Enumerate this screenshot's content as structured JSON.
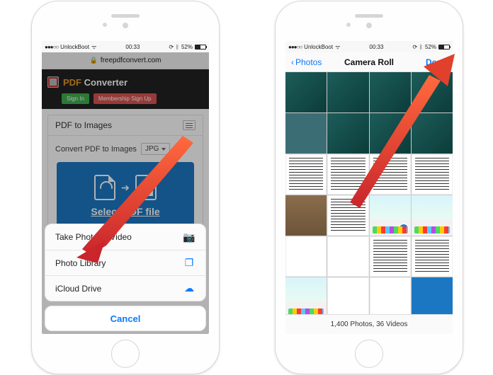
{
  "status": {
    "carrier": "UnlockBoot",
    "time": "00:33",
    "battery_pct": "52%"
  },
  "left": {
    "url": "freepdfconvert.com",
    "brand_pre": "PDF",
    "brand_post": "Converter",
    "signin": "Sign In",
    "signup": "Membership Sign Up",
    "card_title": "PDF to Images",
    "convert_label": "Convert PDF to Images",
    "format": "JPG",
    "select_label": "Select PDF file",
    "sheet": {
      "take": "Take Photo or Video",
      "library": "Photo Library",
      "icloud": "iCloud Drive",
      "cancel": "Cancel"
    }
  },
  "right": {
    "back": "Photos",
    "title": "Camera Roll",
    "done": "Done",
    "count": "1,400 Photos, 36 Videos"
  }
}
